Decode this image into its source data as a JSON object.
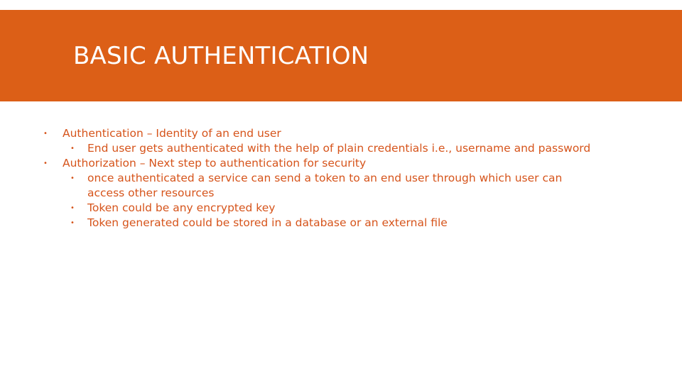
{
  "slide": {
    "title": "BASIC AUTHENTICATION",
    "accent_color": "#dc5f17",
    "text_color": "#d6541b",
    "bullet_symbol": "•",
    "items": [
      {
        "level": 1,
        "text": "Authentication – Identity of an end user"
      },
      {
        "level": 2,
        "text": "End user gets authenticated with the help of plain credentials i.e., username and password"
      },
      {
        "level": 1,
        "text": "Authorization – Next step to authentication for security"
      },
      {
        "level": 2,
        "text": "once authenticated a service can send a token to an end user through which user can access other resources"
      },
      {
        "level": 2,
        "text": "Token could be any encrypted key"
      },
      {
        "level": 2,
        "text": "Token generated could be stored in a database or an external file"
      }
    ]
  }
}
